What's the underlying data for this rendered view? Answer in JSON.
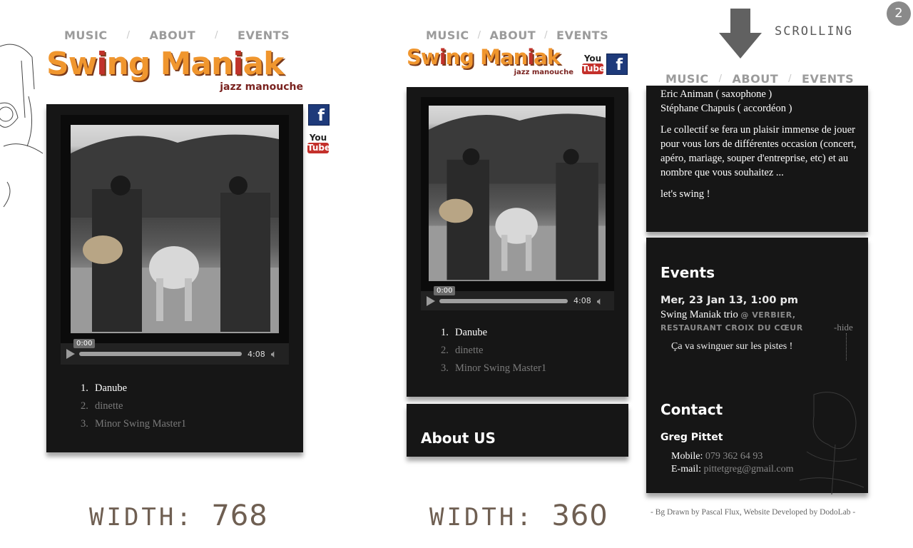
{
  "nav": {
    "music": "MUSIC",
    "about": "ABOUT",
    "events": "EVENTS",
    "sep": "/"
  },
  "logo": {
    "name_part1": "Sw",
    "name_i1": "i",
    "name_part2": "ng Man",
    "name_i2": "i",
    "name_part3": "ak",
    "subtitle": "jazz manouche"
  },
  "social": {
    "facebook": "f",
    "youtube_you": "You",
    "youtube_tube": "Tube"
  },
  "player": {
    "current_time": "0:00",
    "duration": "4:08",
    "progress": 0
  },
  "tracks": [
    {
      "num": "1.",
      "title": "Danube",
      "active": true
    },
    {
      "num": "2.",
      "title": "dinette",
      "active": false
    },
    {
      "num": "3.",
      "title": "Minor Swing Master1",
      "active": false
    }
  ],
  "labels": {
    "width_prefix": "WIDTH:",
    "width_768": "768",
    "width_360": "360",
    "scrolling": "SCROLLING",
    "badge": "2"
  },
  "about_us_title": "About US",
  "about": {
    "line1": "Eric Animan ( saxophone )",
    "line2": "Stéphane Chapuis ( accordéon )",
    "para": "Le collectif se fera un plaisir immense de jouer pour vous lors de différentes occasion (concert, apéro, mariage, souper d'entreprise, etc) et au nombre que vous souhaitez ...",
    "closing": "let's swing !"
  },
  "events": {
    "title": "Events",
    "date": "Mer, 23 Jan 13, 1:00 pm",
    "name": "Swing Maniak trio",
    "location_1": "@ VERBIER,",
    "location_2": "RESTAURANT CROIX DU CŒUR",
    "hide": "-hide",
    "description": "Ça va swinguer sur les pistes !"
  },
  "contact": {
    "title": "Contact",
    "name": "Greg Pittet",
    "mobile_label": "Mobile:",
    "mobile": "079 362 64 93",
    "email_label": "E-mail:",
    "email": "pittetgreg@gmail.com"
  },
  "footer": "- Bg Drawn by Pascal Flux, Website Developed by DodoLab -"
}
